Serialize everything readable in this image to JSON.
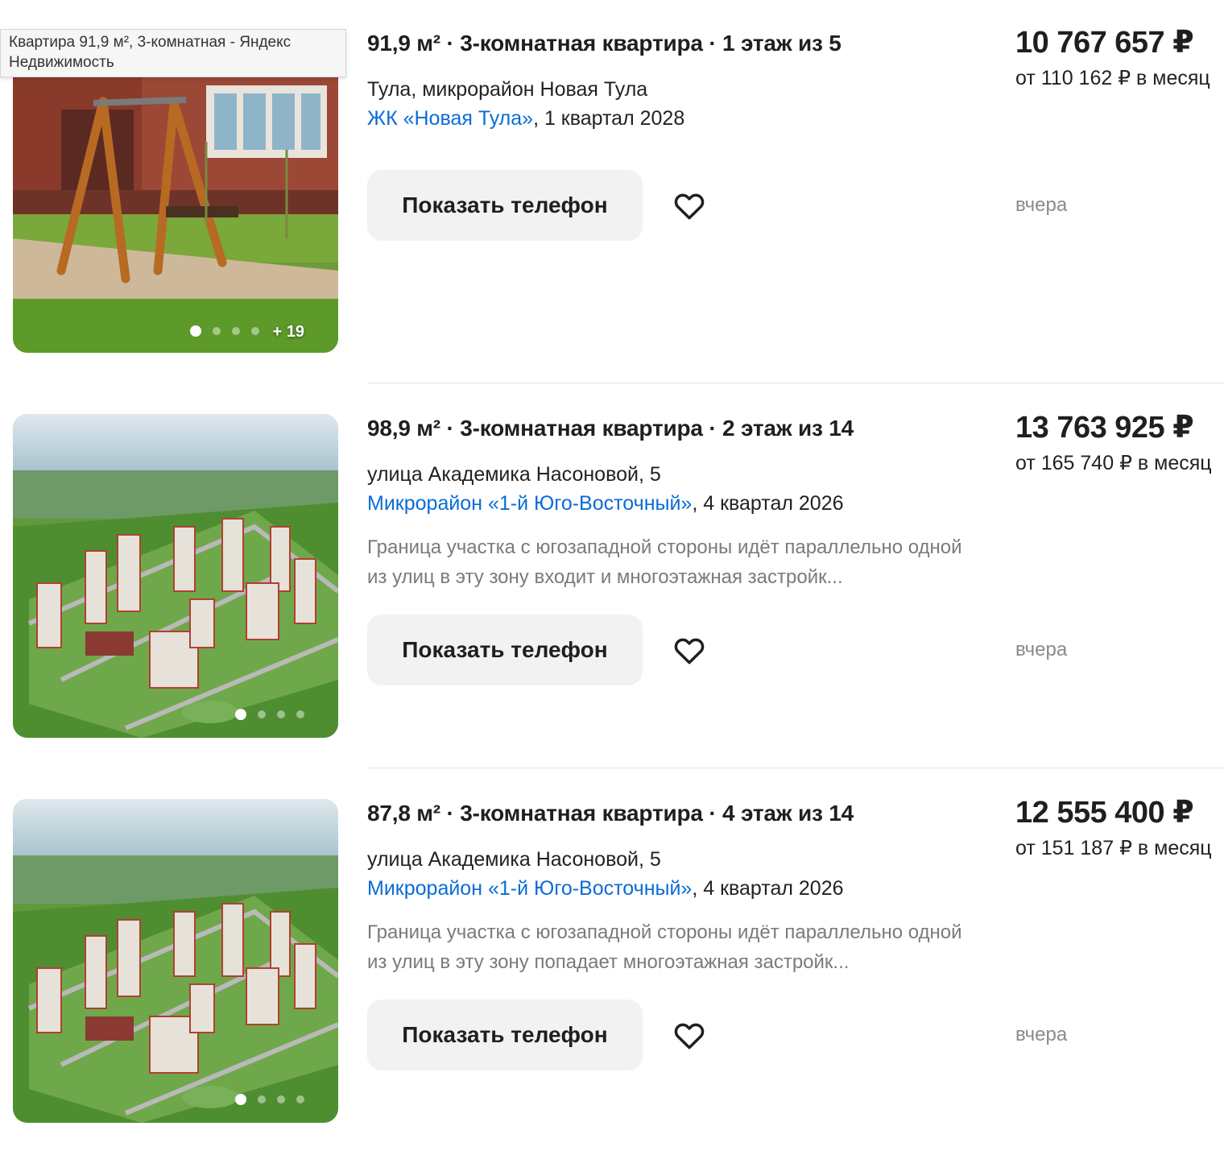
{
  "tooltip": {
    "text": "Квартира 91,9 м², 3-комнатная - Яндекс Недвижимость"
  },
  "listings": [
    {
      "title": "91,9 м² · 3-комнатная квартира · 1 этаж из 5",
      "address": "Тула, микрорайон Новая Тула",
      "complex": "ЖК «Новая Тула»",
      "delivery": ", 1 квартал 2028",
      "description": "",
      "phone_button": "Показать телефон",
      "price": "10 767 657 ₽",
      "monthly": "от 110 162 ₽ в месяц",
      "date": "вчера",
      "photo_count": "+ 19"
    },
    {
      "title": "98,9 м² · 3-комнатная квартира · 2 этаж из 14",
      "address": "улица Академика Насоновой, 5",
      "complex": "Микрорайон «1-й Юго-Восточный»",
      "delivery": ", 4 квартал 2026",
      "description": "Граница участка с югозападной стороны идёт параллельно одной из улиц в эту зону входит и многоэтажная застройк...",
      "phone_button": "Показать телефон",
      "price": "13 763 925 ₽",
      "monthly": "от 165 740 ₽ в месяц",
      "date": "вчера"
    },
    {
      "title": "87,8 м² · 3-комнатная квартира · 4 этаж из 14",
      "address": "улица Академика Насоновой, 5",
      "complex": "Микрорайон «1-й Юго-Восточный»",
      "delivery": ", 4 квартал 2026",
      "description": "Граница участка с югозападной стороны идёт параллельно одной из улиц в эту зону попадает многоэтажная застройк...",
      "phone_button": "Показать телефон",
      "price": "12 555 400 ₽",
      "monthly": "от 151 187 ₽ в месяц",
      "date": "вчера"
    }
  ],
  "colors": {
    "link": "#0a6cd5",
    "button_bg": "#f2f2f2",
    "muted_text": "#7a7a7a"
  },
  "icons": {
    "favorite": "heart-outline-icon"
  }
}
